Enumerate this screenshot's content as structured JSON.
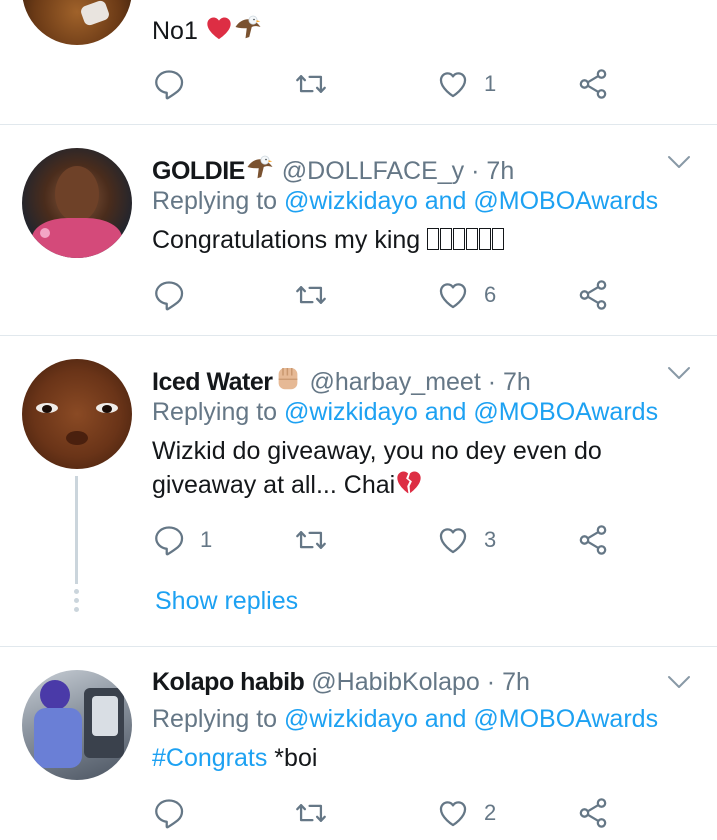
{
  "tweets": [
    {
      "body": "No1",
      "reply_count": "",
      "like_count": "1"
    },
    {
      "name": "GOLDIE",
      "handle": "@DOLLFACE_y",
      "separator": "·",
      "time": "7h",
      "replying_prefix": "Replying to ",
      "replying_to": "@wizkidayo and @MOBOAwards",
      "body": "Congratulations my king",
      "like_count": "6"
    },
    {
      "name": "Iced Water",
      "handle": "@harbay_meet",
      "separator": "·",
      "time": "7h",
      "replying_prefix": "Replying to ",
      "replying_to": "@wizkidayo and @MOBOAwards",
      "body_line1": "Wizkid do giveaway, you no dey even do",
      "body_line2": "giveaway at all... Chai",
      "reply_count": "1",
      "like_count": "3",
      "show_replies": "Show replies"
    },
    {
      "name": "Kolapo habib",
      "handle": "@HabibKolapo",
      "separator": "·",
      "time": "7h",
      "replying_prefix": "Replying to ",
      "replying_to": "@wizkidayo and @MOBOAwards",
      "hashtag": "#Congrats",
      "body_rest": " *boi",
      "like_count": "2"
    }
  ],
  "colors": {
    "link": "#1da1f2",
    "muted": "#657786",
    "divider": "#e1e8ed",
    "heart": "#e0245e"
  },
  "icons": [
    "reply-icon",
    "retweet-icon",
    "like-icon",
    "share-icon",
    "chevron-down-icon",
    "heart-emoji",
    "eagle-emoji",
    "raised-fist-emoji",
    "broken-heart-emoji"
  ]
}
